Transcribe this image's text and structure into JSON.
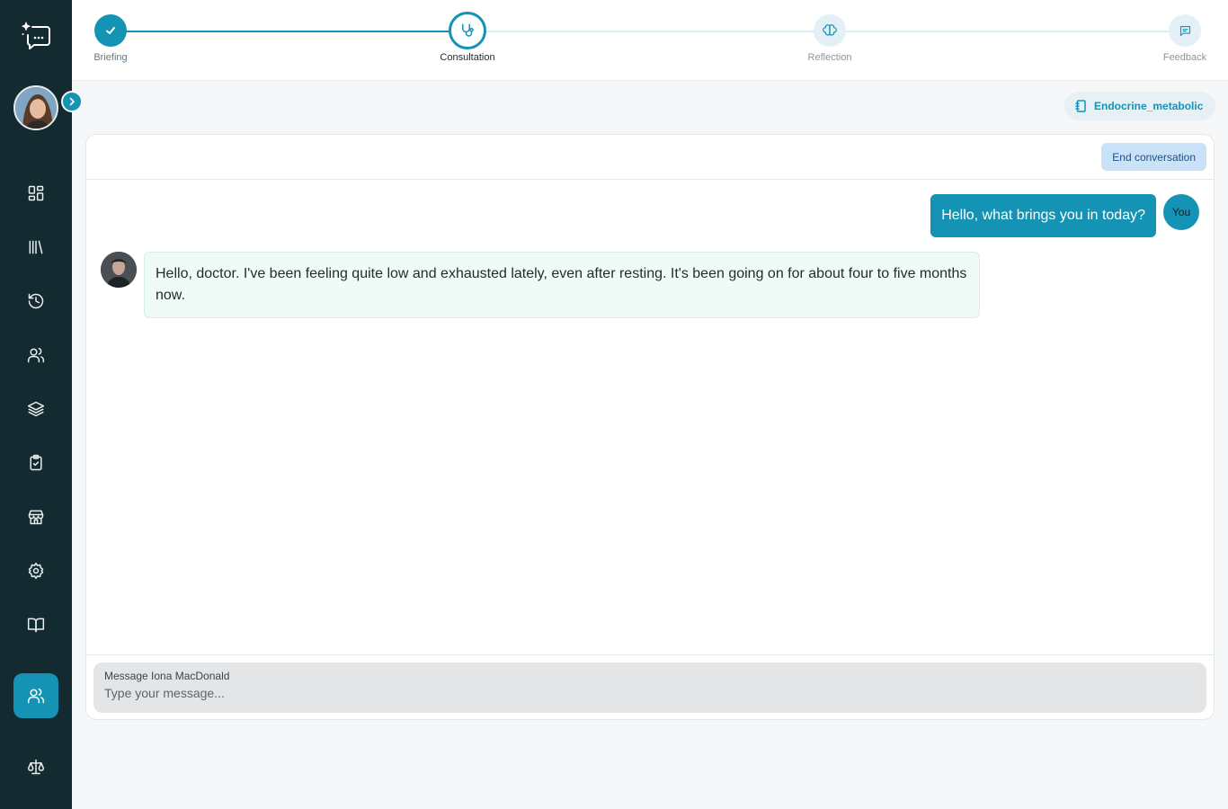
{
  "stepper": {
    "steps": [
      {
        "label": "Briefing",
        "state": "completed",
        "icon": "check-icon"
      },
      {
        "label": "Consultation",
        "state": "active",
        "icon": "stethoscope-icon"
      },
      {
        "label": "Reflection",
        "state": "pending",
        "icon": "brain-icon"
      },
      {
        "label": "Feedback",
        "state": "pending",
        "icon": "message-square-icon"
      }
    ]
  },
  "sidebar": {
    "nav_icons": [
      "dashboard-icon",
      "library-icon",
      "history-icon",
      "users-icon",
      "layers-icon",
      "clipboard-check-icon",
      "store-icon",
      "settings-icon",
      "book-open-icon",
      "users-icon",
      "scale-icon"
    ],
    "active_icon": "users-icon"
  },
  "case_tag": {
    "label": "Endocrine_metabolic",
    "icon": "notebook-icon"
  },
  "chat": {
    "end_button": "End conversation",
    "user_label": "You",
    "messages": [
      {
        "sender": "user",
        "text": "Hello, what brings you in today?"
      },
      {
        "sender": "patient",
        "text": "Hello, doctor. I've been feeling quite low and exhausted lately, even after resting. It's been going on for about four to five months now."
      }
    ],
    "composer": {
      "label": "Message Iona MacDonald",
      "placeholder": "Type your message..."
    }
  },
  "colors": {
    "sidebar_bg": "#122a30",
    "accent": "#1593b4",
    "patient_bubble": "#f0fbf8",
    "end_button_bg": "#c9e2f8"
  }
}
